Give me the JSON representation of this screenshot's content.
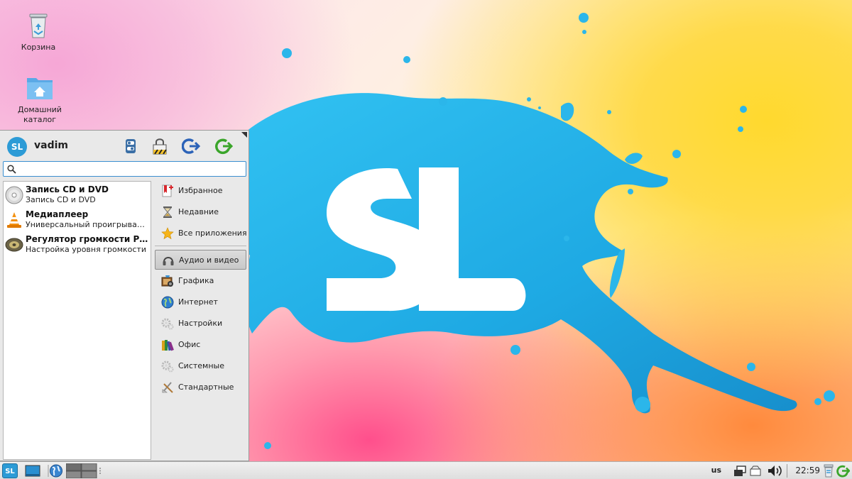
{
  "desktop": {
    "icons": [
      {
        "label": "Корзина"
      },
      {
        "label": "Домашний каталог"
      }
    ],
    "wallpaper_logo": "SL"
  },
  "menu": {
    "avatar_text": "SL",
    "username": "vadim",
    "header_buttons": [
      "settings-icon",
      "lock-icon",
      "logout-icon",
      "restart-icon"
    ],
    "search": {
      "value": "",
      "placeholder": ""
    },
    "apps": [
      {
        "name": "Запись CD и DVD",
        "desc": "Запись CD и DVD",
        "icon": "disc-icon"
      },
      {
        "name": "Медиаплеер",
        "desc": "Универсальный проигрыватель",
        "icon": "vlc-icon"
      },
      {
        "name": "Регулятор громкости PulseAudio",
        "desc": "Настройка уровня громкости",
        "icon": "speaker-icon"
      }
    ],
    "categories": [
      {
        "label": "Избранное",
        "icon": "bookmark-icon"
      },
      {
        "label": "Недавние",
        "icon": "hourglass-icon"
      },
      {
        "label": "Все приложения",
        "icon": "star-icon"
      },
      {
        "label": "Аудио и видео",
        "icon": "headphones-icon",
        "active": true
      },
      {
        "label": "Графика",
        "icon": "graphics-icon"
      },
      {
        "label": "Интернет",
        "icon": "globe-icon"
      },
      {
        "label": "Настройки",
        "icon": "gears-icon"
      },
      {
        "label": "Офис",
        "icon": "books-icon"
      },
      {
        "label": "Системные",
        "icon": "gears-icon"
      },
      {
        "label": "Стандартные",
        "icon": "tools-icon"
      }
    ]
  },
  "panel": {
    "start_label": "SL",
    "keyboard_layout": "us",
    "clock": "22:59"
  },
  "colors": {
    "accent": "#2c9bd6",
    "splash": "#2bb6ea"
  }
}
